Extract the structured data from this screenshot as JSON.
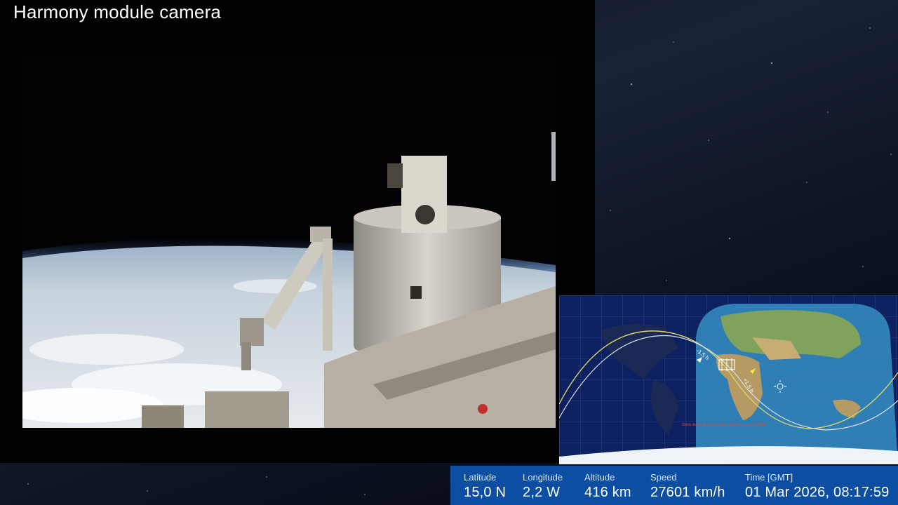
{
  "camera": {
    "title": "Harmony module camera"
  },
  "map": {
    "note": "Orbits drawn using the same ISS time, CLOUDS AND",
    "ground_track_labels": [
      "-1.5 h",
      "+1.5 h"
    ]
  },
  "telemetry": {
    "latitude": {
      "label": "Latitude",
      "value": "15,0 N"
    },
    "longitude": {
      "label": "Longitude",
      "value": "2,2 W"
    },
    "altitude": {
      "label": "Altitude",
      "value": "416 km"
    },
    "speed": {
      "label": "Speed",
      "value": "27601 km/h"
    },
    "time": {
      "label": "Time [GMT]",
      "value": "01 Mar 2026, 08:17:59"
    }
  }
}
